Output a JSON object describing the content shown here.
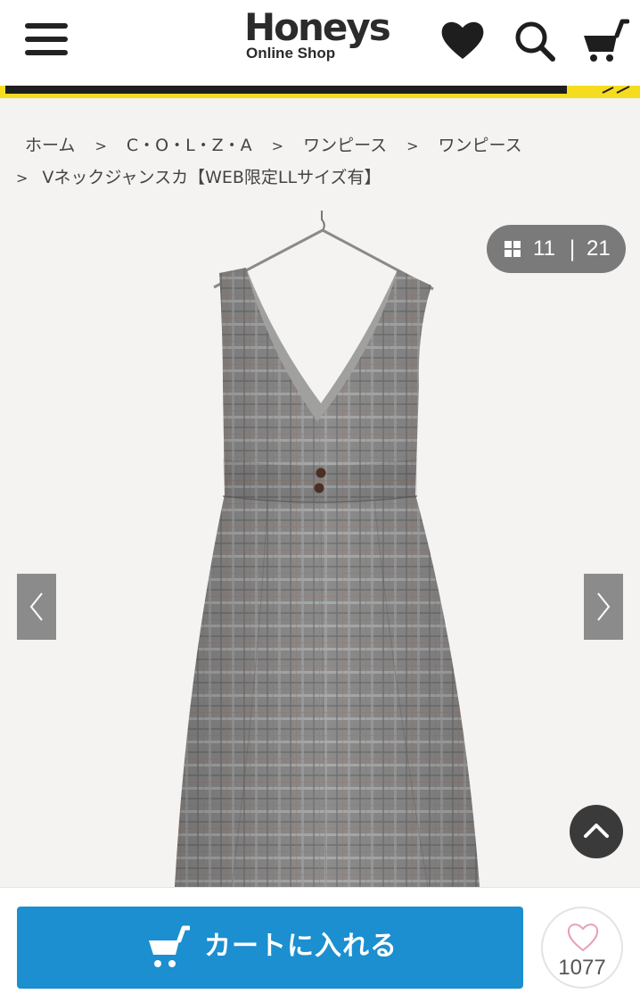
{
  "header": {
    "logo_main": "Honeys",
    "logo_sub": "Online Shop"
  },
  "breadcrumb": {
    "items": [
      "ホーム",
      "C・O・L・Z・A",
      "ワンピース",
      "ワンピース"
    ],
    "separator": ">",
    "current": "Vネックジャンスカ【WEB限定LLサイズ有】"
  },
  "gallery": {
    "current": "11",
    "divider": "|",
    "total": "21",
    "prev_icon": "chevron-left-icon",
    "next_icon": "chevron-right-icon"
  },
  "actions": {
    "add_to_cart": "カートに入れる",
    "favorite_count": "1077"
  },
  "colors": {
    "accent_blue": "#1b8fcf",
    "banner_yellow": "#f5dc1e",
    "counter_gray": "#7a7a7a"
  }
}
